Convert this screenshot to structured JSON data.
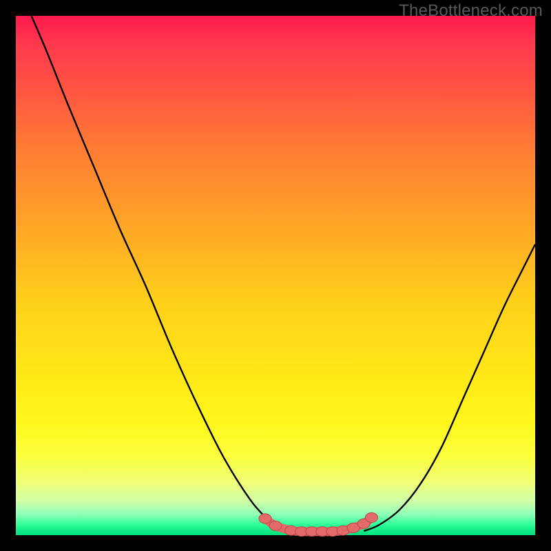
{
  "watermark": "TheBottleneck.com",
  "colors": {
    "frame": "#000000",
    "curve": "#000000",
    "marker_fill": "#e46a6a",
    "marker_stroke": "#b74848"
  },
  "chart_data": {
    "type": "line",
    "title": "",
    "xlabel": "",
    "ylabel": "",
    "xlim": [
      0,
      100
    ],
    "ylim": [
      0,
      100
    ],
    "grid": false,
    "legend": false,
    "series": [
      {
        "name": "left-curve",
        "x": [
          3,
          6,
          10,
          15,
          20,
          25,
          30,
          35,
          40,
          45,
          48,
          50,
          52
        ],
        "y": [
          100,
          93,
          83,
          71,
          59,
          48,
          36,
          25,
          15,
          7,
          3.5,
          1.5,
          0.8
        ]
      },
      {
        "name": "right-curve",
        "x": [
          67,
          70,
          74,
          78,
          82,
          86,
          90,
          94,
          98,
          100
        ],
        "y": [
          0.8,
          2,
          5,
          10,
          17,
          26,
          35,
          44,
          52,
          56
        ]
      },
      {
        "name": "floor-markers",
        "x": [
          48,
          50,
          53,
          55,
          57,
          59,
          61,
          63,
          65,
          67,
          68.5
        ],
        "y": [
          3.2,
          1.8,
          0.9,
          0.7,
          0.7,
          0.7,
          0.7,
          0.9,
          1.4,
          2.2,
          3.4
        ]
      }
    ],
    "annotations": []
  }
}
